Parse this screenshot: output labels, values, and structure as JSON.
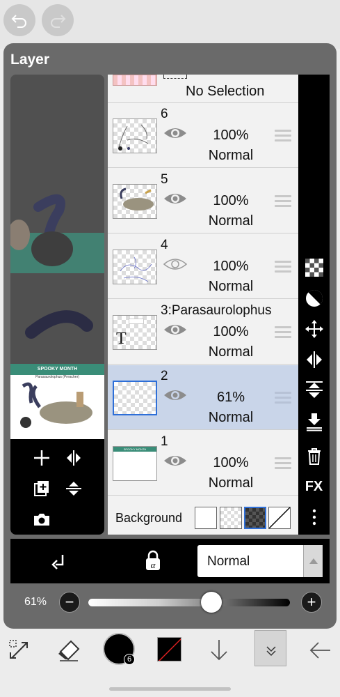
{
  "panel": {
    "title": "Layer"
  },
  "top": {
    "undo_icon": "undo-icon",
    "redo_icon": "redo-icon"
  },
  "preview": {
    "thumb_title": "SPOOKY MONTH",
    "thumb_subtitle": "Parasaurolophus (Preacher)"
  },
  "layers": {
    "partial_label": "No Selection",
    "rows": [
      {
        "name": "6",
        "opacity": "100%",
        "blend": "Normal",
        "visible": true,
        "selected": false
      },
      {
        "name": "5",
        "opacity": "100%",
        "blend": "Normal",
        "visible": true,
        "selected": false
      },
      {
        "name": "4",
        "opacity": "100%",
        "blend": "Normal",
        "visible": false,
        "selected": false
      },
      {
        "name": "3:Parasaurolophus",
        "opacity": "100%",
        "blend": "Normal",
        "visible": true,
        "selected": false
      },
      {
        "name": "2",
        "opacity": "61%",
        "blend": "Normal",
        "visible": true,
        "selected": true
      },
      {
        "name": "1",
        "opacity": "100%",
        "blend": "Normal",
        "visible": true,
        "selected": false
      }
    ],
    "thumb_text_label": "T",
    "layer1_thumb_title": "SPOOKY MONTH",
    "background_label": "Background"
  },
  "right_tools": {
    "fx_label": "FX"
  },
  "blend_bar": {
    "mode_value": "Normal"
  },
  "opacity_slider": {
    "label": "61%",
    "value": 0.61,
    "minus": "−",
    "plus": "+"
  },
  "bottom": {
    "brush_size": "6"
  },
  "colors": {
    "accent": "#2e6fd8",
    "selected_row": "#c9d5e9",
    "teal": "#3a8d78"
  }
}
